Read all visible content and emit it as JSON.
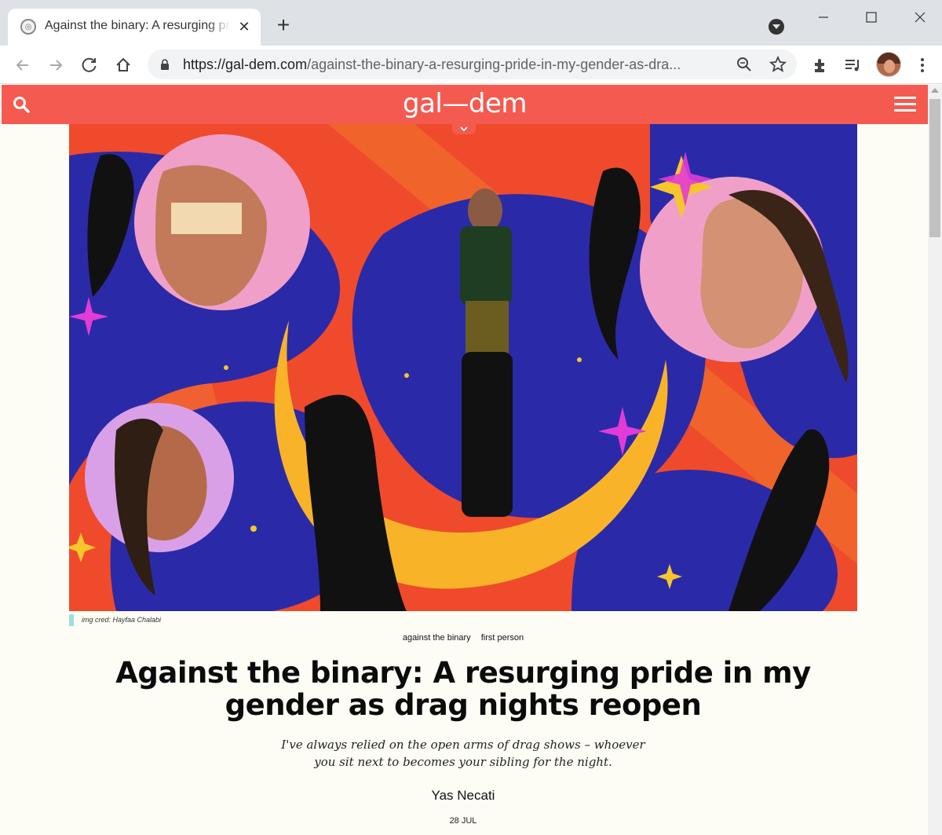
{
  "browser": {
    "tab_title": "Against the binary: A resurging pride in my gender as drag nights reopen",
    "tab_close_glyph": "✕",
    "new_tab_glyph": "+",
    "url_host": "https://gal-dem.com",
    "url_path": "/against-the-binary-a-resurging-pride-in-my-gender-as-dra...",
    "icons": [
      "back-icon",
      "forward-icon",
      "reload-icon",
      "home-icon",
      "lock-icon",
      "zoom-icon",
      "bookmark-star-icon",
      "extensions-icon",
      "reading-list-icon",
      "profile-avatar",
      "kebab-menu-icon"
    ]
  },
  "site": {
    "logo": "gal—dem",
    "brand_color": "#f45a4f"
  },
  "hero": {
    "caption": "img cred: Hayfaa Chalabi"
  },
  "article": {
    "tags": [
      "against the binary",
      "first person"
    ],
    "headline_line1": "Against the binary: A resurging pride in my",
    "headline_line2": "gender as drag nights reopen",
    "standfirst_line1": "I've always relied on the open arms of drag shows – whoever",
    "standfirst_line2": "you sit next to becomes your sibling for the night.",
    "author": "Yas Necati",
    "date": "28 JUL"
  }
}
